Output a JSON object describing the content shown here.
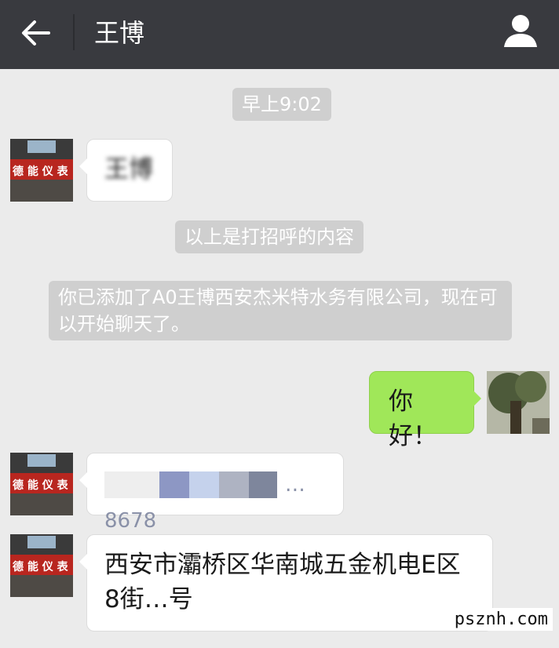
{
  "header": {
    "title": "王博"
  },
  "chat": {
    "timestamp": "早上9:02",
    "greeting_note": "以上是打招呼的内容",
    "added_notice": "你已添加了A0王博西安杰米特水务有限公司，现在可以开始聊天了。",
    "avatar_sign_text": "德 能 仪 表",
    "messages": [
      {
        "side": "left",
        "text": "王博"
      },
      {
        "side": "right",
        "text": "你好！"
      },
      {
        "side": "left",
        "text": "…8678"
      },
      {
        "side": "left",
        "text": "西安市灞桥区华南城五金机电E区8街…号"
      }
    ]
  },
  "watermark": "psznh.com",
  "colors": {
    "topbar": "#393a3f",
    "chat_background": "#ebebeb",
    "sent_bubble": "#a0e759",
    "received_bubble": "#ffffff",
    "system_pill": "#cfcfcf"
  }
}
